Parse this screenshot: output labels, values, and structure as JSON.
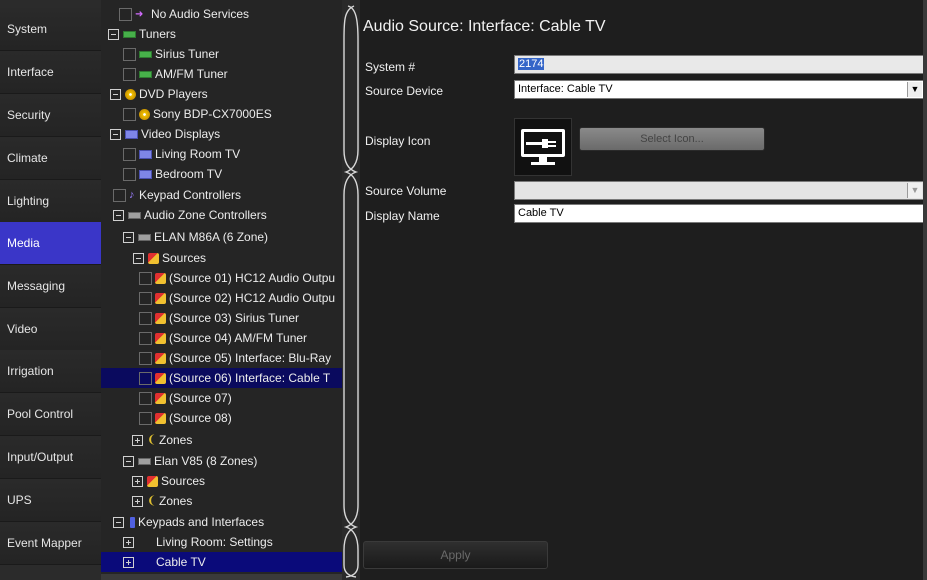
{
  "nav": {
    "items": [
      {
        "label": "System"
      },
      {
        "label": "Interface"
      },
      {
        "label": "Security"
      },
      {
        "label": "Climate"
      },
      {
        "label": "Lighting"
      },
      {
        "label": "Media",
        "active": true
      },
      {
        "label": "Messaging"
      },
      {
        "label": "Video"
      },
      {
        "label": "Irrigation"
      },
      {
        "label": "Pool Control"
      },
      {
        "label": "Input/Output"
      },
      {
        "label": "UPS"
      },
      {
        "label": "Event Mapper"
      }
    ]
  },
  "tree": {
    "rows": [
      {
        "label": "No Audio Services",
        "icon": "arrow-icon"
      },
      {
        "label": "Tuners",
        "icon": "tuner-icon"
      },
      {
        "label": "Sirius Tuner",
        "icon": "tuner-icon"
      },
      {
        "label": "AM/FM Tuner",
        "icon": "tuner-icon"
      },
      {
        "label": "DVD Players",
        "icon": "disc-icon"
      },
      {
        "label": "Sony BDP-CX7000ES",
        "icon": "disc-icon"
      },
      {
        "label": "Video Displays",
        "icon": "screen-icon"
      },
      {
        "label": "Living Room TV",
        "icon": "screen-icon"
      },
      {
        "label": "Bedroom TV",
        "icon": "screen-icon"
      },
      {
        "label": "Keypad Controllers",
        "icon": "note-icon"
      },
      {
        "label": "Audio Zone Controllers",
        "icon": "amp-icon"
      },
      {
        "label": "ELAN M86A (6 Zone)",
        "icon": "amp-icon"
      },
      {
        "label": "Sources",
        "icon": "source-icon"
      },
      {
        "label": "(Source 01) HC12 Audio Outpu",
        "icon": "source-icon"
      },
      {
        "label": "(Source 02) HC12 Audio Outpu",
        "icon": "source-icon"
      },
      {
        "label": "(Source 03) Sirius Tuner",
        "icon": "source-icon"
      },
      {
        "label": "(Source 04) AM/FM Tuner",
        "icon": "source-icon"
      },
      {
        "label": "(Source 05) Interface: Blu-Ray",
        "icon": "source-icon"
      },
      {
        "label": "(Source 06) Interface: Cable T",
        "icon": "source-icon",
        "selected": true
      },
      {
        "label": "(Source 07)",
        "icon": "source-icon"
      },
      {
        "label": "(Source 08)",
        "icon": "source-icon"
      },
      {
        "label": "Zones",
        "icon": "zone-icon"
      },
      {
        "label": "Elan V85 (8 Zones)",
        "icon": "amp-icon"
      },
      {
        "label": "Sources",
        "icon": "source-icon"
      },
      {
        "label": "Zones",
        "icon": "zone-icon"
      },
      {
        "label": "Keypads and Interfaces",
        "icon": "keypad-icon"
      },
      {
        "label": "Living Room: Settings",
        "icon": ""
      },
      {
        "label": "Cable TV",
        "icon": "",
        "selected": true
      }
    ]
  },
  "details": {
    "title": "Audio Source: Interface: Cable TV",
    "system_label": "System #",
    "system_value": "2174",
    "source_device_label": "Source Device",
    "source_device_value": "Interface: Cable TV",
    "display_icon_label": "Display Icon",
    "select_icon_label": "Select Icon...",
    "source_volume_label": "Source Volume",
    "source_volume_value": "",
    "display_name_label": "Display Name",
    "display_name_value": "Cable TV",
    "apply_label": "Apply"
  }
}
